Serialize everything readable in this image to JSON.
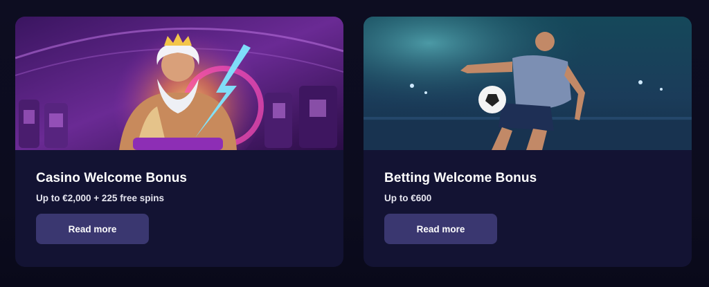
{
  "cards": [
    {
      "title": "Casino Welcome Bonus",
      "subtitle": "Up to €2,000 + 225 free spins",
      "button_label": "Read more",
      "image": "casino-zeus-illustration"
    },
    {
      "title": "Betting Welcome Bonus",
      "subtitle": "Up to €600",
      "button_label": "Read more",
      "image": "football-player-illustration"
    }
  ],
  "colors": {
    "page_bg": "#0c0c1e",
    "card_bg": "#131333",
    "button_bg": "#3a3770",
    "text": "#ffffff"
  }
}
